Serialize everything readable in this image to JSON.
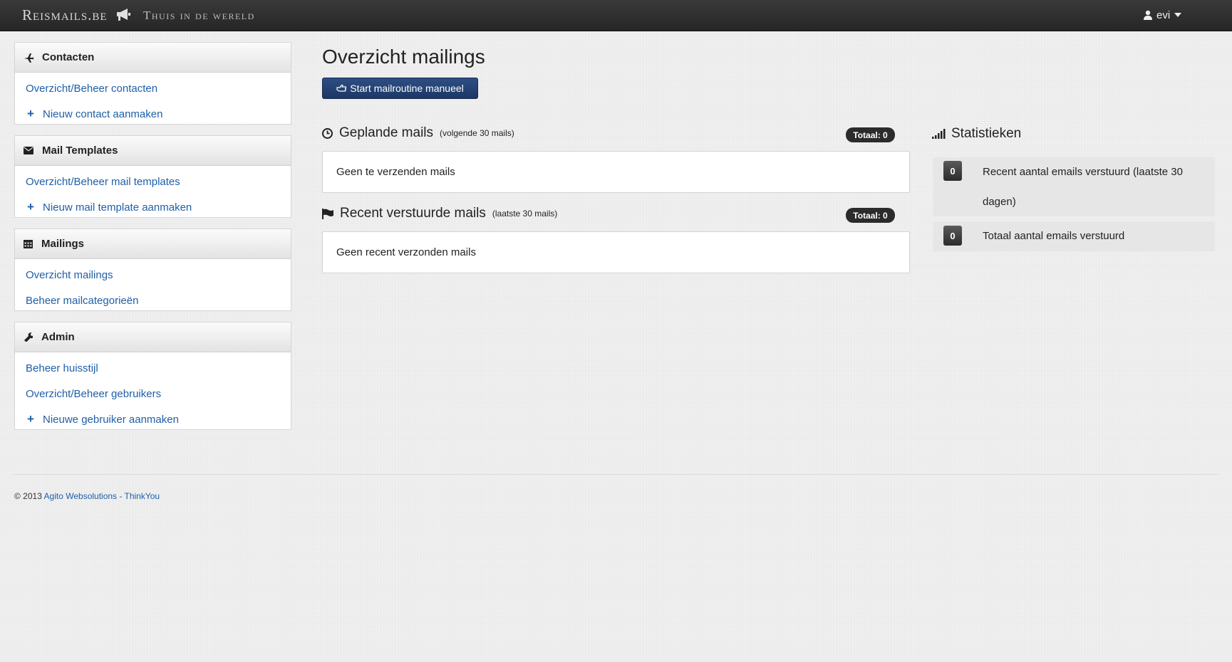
{
  "navbar": {
    "brand": "Reismails.be",
    "brand_icon": "megaphone-icon",
    "tagline": "Thuis in de wereld",
    "user": "evi"
  },
  "sidebar": {
    "contacten": {
      "title": "Contacten",
      "icon": "plane-icon",
      "links": [
        "Overzicht/Beheer contacten",
        "Nieuw contact aanmaken"
      ]
    },
    "templates": {
      "title": "Mail Templates",
      "icon": "envelope-icon",
      "links": [
        "Overzicht/Beheer mail templates",
        "Nieuw mail template aanmaken"
      ]
    },
    "mailings": {
      "title": "Mailings",
      "icon": "calendar-icon",
      "links": [
        "Overzicht mailings",
        "Beheer mailcategorieën"
      ]
    },
    "admin": {
      "title": "Admin",
      "icon": "wrench-icon",
      "links": [
        "Beheer huisstijl",
        "Overzicht/Beheer gebruikers",
        "Nieuwe gebruiker aanmaken"
      ]
    }
  },
  "main": {
    "title": "Overzicht mailings",
    "start_button": "Start mailroutine manueel",
    "planned": {
      "title": "Geplande mails",
      "subtitle": "(volgende 30 mails)",
      "badge": "Totaal: 0",
      "empty": "Geen te verzenden mails"
    },
    "recent": {
      "title": "Recent verstuurde mails",
      "subtitle": "(laatste 30 mails)",
      "badge": "Totaal: 0",
      "empty": "Geen recent verzonden mails"
    }
  },
  "stats": {
    "title": "Statistieken",
    "items": [
      {
        "value": "0",
        "label": "Recent aantal emails verstuurd (laatste 30 dagen)"
      },
      {
        "value": "0",
        "label": "Totaal aantal emails verstuurd"
      }
    ]
  },
  "footer": {
    "copyright": "© 2013",
    "link": "Agito Websolutions - ThinkYou"
  },
  "colors": {
    "link": "#1f5fa8",
    "navbar": "#2e2e2e",
    "primary_button": "#24426f"
  }
}
